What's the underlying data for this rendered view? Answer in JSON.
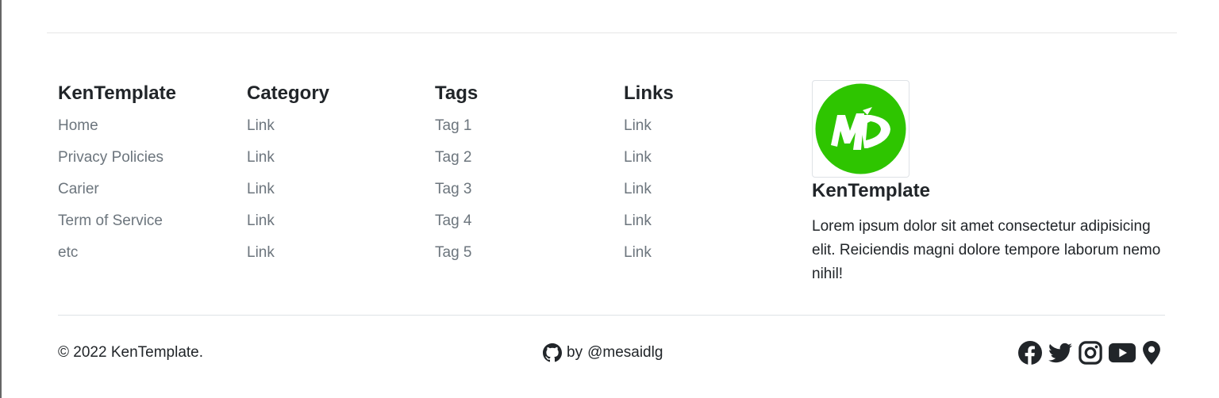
{
  "footer": {
    "columns": [
      {
        "title": "KenTemplate",
        "items": [
          "Home",
          "Privacy Policies",
          "Carier",
          "Term of Service",
          "etc"
        ]
      },
      {
        "title": "Category",
        "items": [
          "Link",
          "Link",
          "Link",
          "Link",
          "Link"
        ]
      },
      {
        "title": "Tags",
        "items": [
          "Tag 1",
          "Tag 2",
          "Tag 3",
          "Tag 4",
          "Tag 5"
        ]
      },
      {
        "title": "Links",
        "items": [
          "Link",
          "Link",
          "Link",
          "Link",
          "Link"
        ]
      }
    ],
    "brand": {
      "logo_icon": "md-logo-icon",
      "logo_color": "#2ec500",
      "title": "KenTemplate",
      "description": "Lorem ipsum dolor sit amet consectetur adipisicing elit. Reiciendis magni dolore tempore laborum nemo nihil!"
    }
  },
  "bottom": {
    "copyright": "© 2022 KenTemplate.",
    "credit_prefix": "by",
    "credit_handle": "@mesaidlg",
    "credit_icon": "github-icon",
    "socials": [
      "facebook-icon",
      "twitter-icon",
      "instagram-icon",
      "youtube-icon",
      "map-pin-icon"
    ]
  }
}
